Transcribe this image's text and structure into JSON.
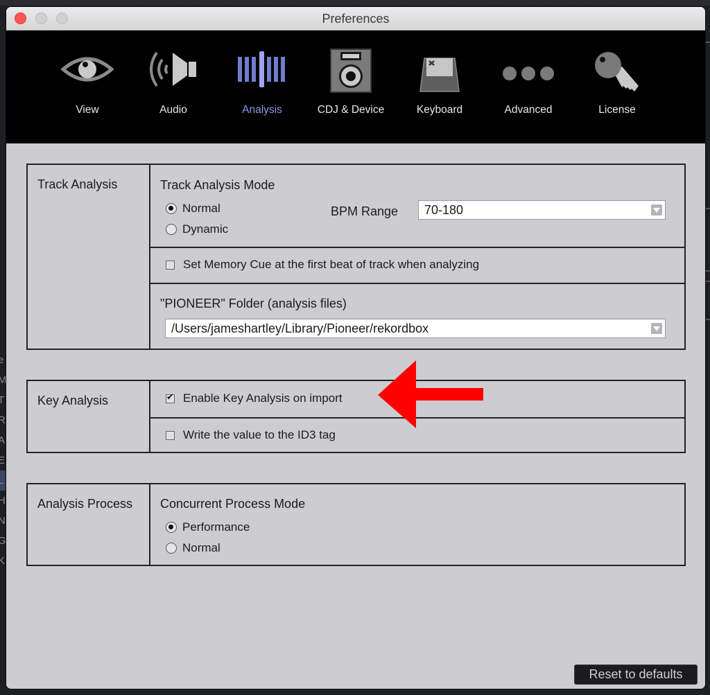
{
  "window": {
    "title": "Preferences",
    "controls": {
      "close": "close",
      "minimize": "minimize",
      "zoom": "zoom"
    }
  },
  "background_app": {
    "left_letters": [
      "e",
      "M",
      "T",
      "R",
      "A",
      "E",
      "L",
      "H",
      "N",
      "G",
      "KE"
    ]
  },
  "toolbar": {
    "active": "Analysis",
    "active_color": "#8f99e6",
    "items": [
      {
        "label": "View",
        "icon": "eye-icon"
      },
      {
        "label": "Audio",
        "icon": "speaker-icon"
      },
      {
        "label": "Analysis",
        "icon": "waveform-bars-icon"
      },
      {
        "label": "CDJ & Device",
        "icon": "cdj-device-icon"
      },
      {
        "label": "Keyboard",
        "icon": "keyboard-key-icon"
      },
      {
        "label": "Advanced",
        "icon": "ellipsis-icon"
      },
      {
        "label": "License",
        "icon": "key-icon"
      }
    ]
  },
  "track_analysis": {
    "group_label": "Track Analysis",
    "mode_title": "Track Analysis Mode",
    "mode_options": [
      {
        "label": "Normal",
        "selected": true
      },
      {
        "label": "Dynamic",
        "selected": false
      }
    ],
    "bpm_range_label": "BPM Range",
    "bpm_range_value": "70-180",
    "memory_cue": {
      "label": "Set Memory Cue at the first beat of track when analyzing",
      "checked": false
    },
    "folder_title": "\"PIONEER\" Folder (analysis files)",
    "folder_value": "/Users/jameshartley/Library/Pioneer/rekordbox"
  },
  "key_analysis": {
    "group_label": "Key Analysis",
    "enable_on_import": {
      "label": "Enable Key Analysis on import",
      "checked": true
    },
    "write_id3": {
      "label": "Write the value to the ID3 tag",
      "checked": false
    }
  },
  "analysis_process": {
    "group_label": "Analysis Process",
    "mode_title": "Concurrent Process Mode",
    "mode_options": [
      {
        "label": "Performance",
        "selected": true
      },
      {
        "label": "Normal",
        "selected": false
      }
    ]
  },
  "footer": {
    "reset_label": "Reset to defaults"
  },
  "annotation": {
    "arrow_color": "#fe0000",
    "points_to": "Enable Key Analysis on import"
  }
}
